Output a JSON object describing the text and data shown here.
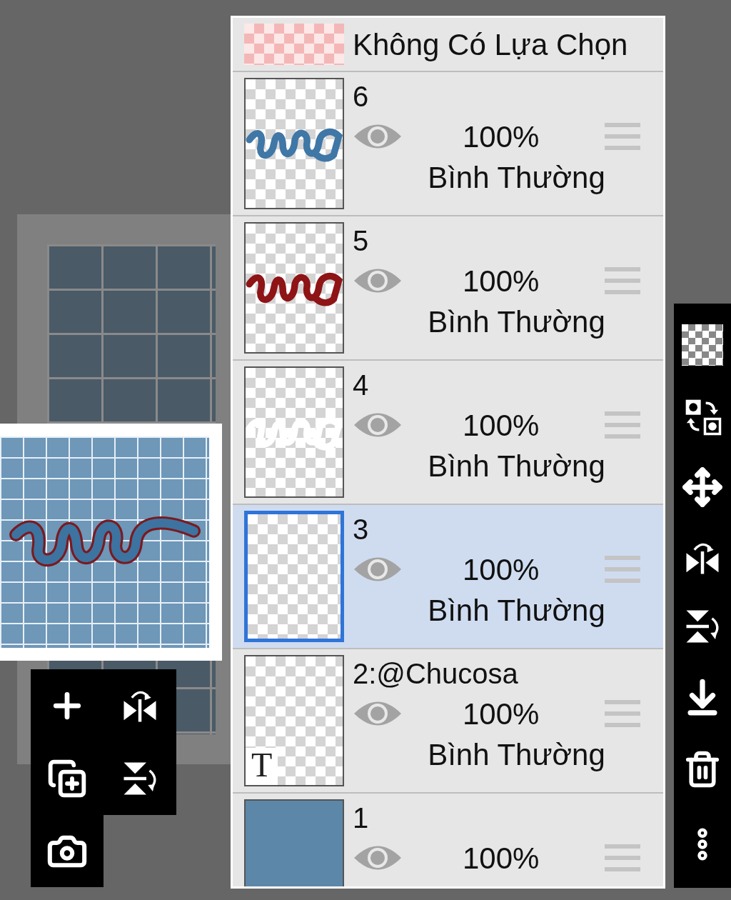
{
  "layer_panel": {
    "selection_row": {
      "label": "Không Có Lựa Chọn"
    },
    "layers": [
      {
        "name": "6",
        "kind": "art",
        "color": "#3f77a6",
        "visible": true,
        "opacity": "100%",
        "blend": "Bình Thường",
        "selected": false
      },
      {
        "name": "5",
        "kind": "art",
        "color": "#8e1416",
        "visible": true,
        "opacity": "100%",
        "blend": "Bình Thường",
        "selected": false
      },
      {
        "name": "4",
        "kind": "art",
        "color": "#ffffff",
        "visible": true,
        "opacity": "100%",
        "blend": "Bình Thường",
        "selected": false
      },
      {
        "name": "3",
        "kind": "empty",
        "visible": true,
        "opacity": "100%",
        "blend": "Bình Thường",
        "selected": true
      },
      {
        "name": "2:@Chucosa",
        "kind": "text",
        "type_badge": "T",
        "visible": true,
        "opacity": "100%",
        "blend": "Bình Thường",
        "selected": false
      },
      {
        "name": "1",
        "kind": "photo",
        "visible": true,
        "opacity": "100%",
        "selected": false
      }
    ]
  }
}
